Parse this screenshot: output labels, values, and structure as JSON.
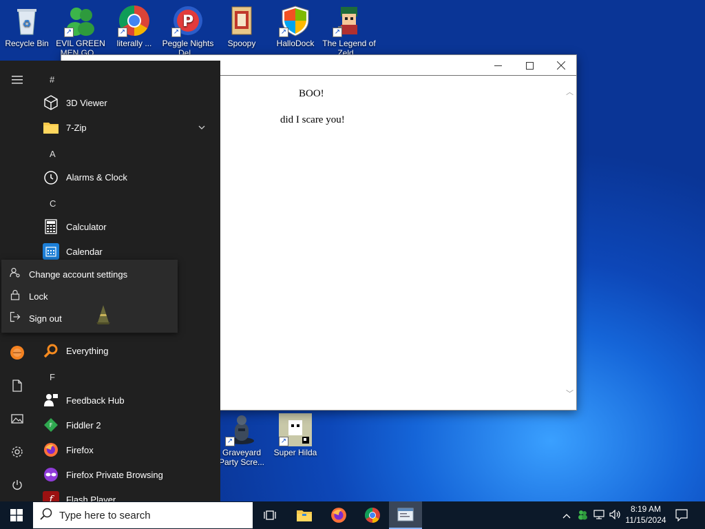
{
  "desktop": {
    "icons_top": [
      {
        "label": "Recycle Bin",
        "icon": "recycle-bin-icon"
      },
      {
        "label": "EVIL GREEN MEN GO...",
        "icon": "green-men-icon"
      },
      {
        "label": "literally ...",
        "icon": "chrome-icon"
      },
      {
        "label": "Peggle Nights Del...",
        "icon": "peggle-icon"
      },
      {
        "label": "Spoopy",
        "icon": "spoopy-icon"
      },
      {
        "label": "HalloDock",
        "icon": "windows-shield-icon"
      },
      {
        "label": "The Legend of Zeld...",
        "icon": "legend-icon"
      }
    ],
    "icons_bottom": [
      {
        "label": "Graveyard Party Scre...",
        "icon": "graveyard-icon"
      },
      {
        "label": "Super Hilda",
        "icon": "super-hilda-icon"
      }
    ]
  },
  "document": {
    "line1": "BOO!",
    "line2": "did I scare you!"
  },
  "start_menu": {
    "rail": [
      "hamburger-icon",
      "user-avatar",
      "document-icon",
      "pictures-icon",
      "settings-icon",
      "power-icon"
    ],
    "sections": {
      "hash": "#",
      "a": "A",
      "c": "C",
      "f": "F"
    },
    "apps": {
      "viewer3d": "3D Viewer",
      "zip7": "7-Zip",
      "alarms": "Alarms & Clock",
      "calculator": "Calculator",
      "calendar": "Calendar",
      "everything": "Everything",
      "feedback": "Feedback Hub",
      "fiddler": "Fiddler 2",
      "firefox": "Firefox",
      "firefox_private": "Firefox Private Browsing",
      "flash": "Flash Player"
    },
    "account_flyout": {
      "change_settings": "Change account settings",
      "lock": "Lock",
      "sign_out": "Sign out"
    }
  },
  "taskbar": {
    "search_placeholder": "Type here to search",
    "time": "8:19 AM",
    "date": "11/15/2024"
  }
}
